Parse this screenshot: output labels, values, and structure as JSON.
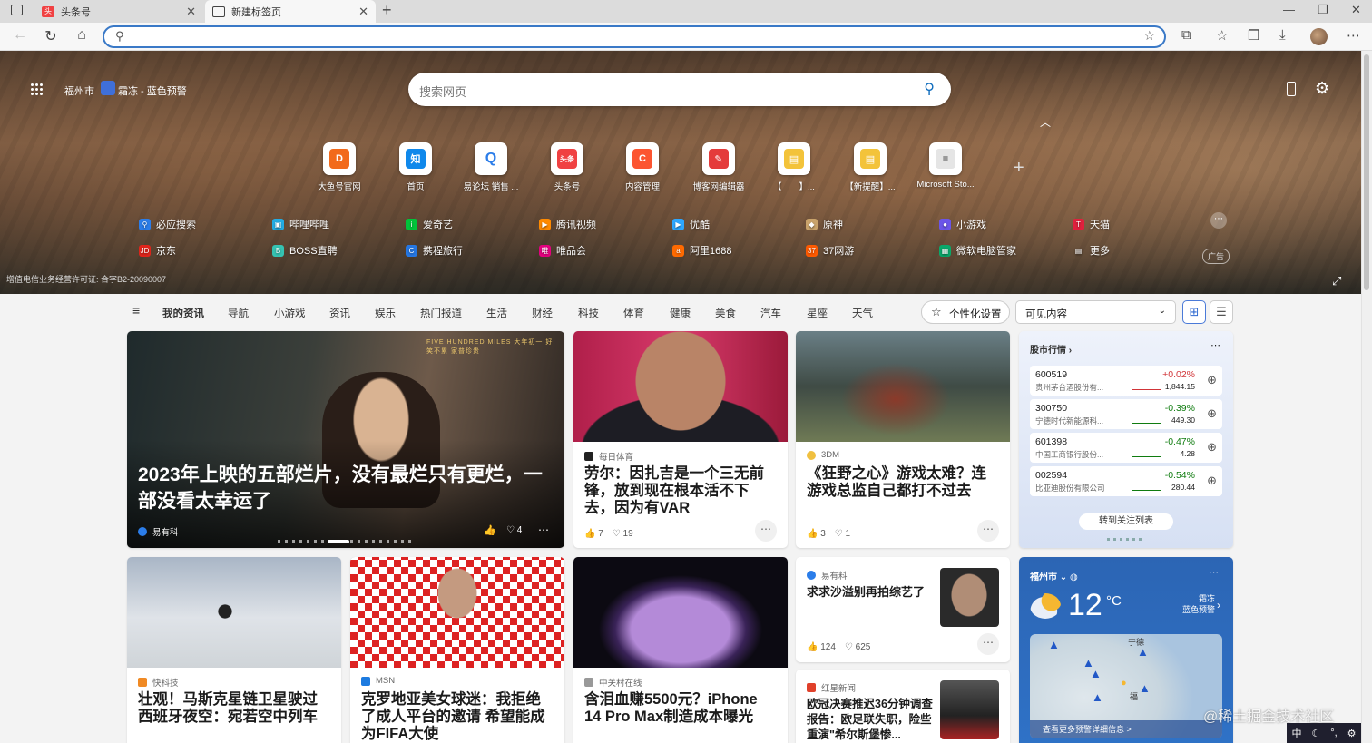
{
  "browser": {
    "tabs": [
      {
        "label": "头条号",
        "icon": "toutiao-icon"
      },
      {
        "label": "新建标签页",
        "icon": "newtab-icon"
      }
    ],
    "new_tab": "+",
    "window": {
      "min": "—",
      "max": "❐",
      "close": "✕"
    }
  },
  "hero": {
    "location": "福州市",
    "alert": "霜冻 - 蓝色预警",
    "search_placeholder": "搜索网页",
    "license": "增值电信业务经营许可证: 合字B2-20090007",
    "ad_badge": "广告",
    "quicklinks": [
      {
        "label": "大鱼号官网",
        "glyph": "D",
        "color": "#f26a1b"
      },
      {
        "label": "首页",
        "glyph": "知",
        "color": "#0f88eb"
      },
      {
        "label": "易论坛 销售 ...",
        "glyph": "Q",
        "color": "#2b7de9"
      },
      {
        "label": "头条号",
        "glyph": "头条",
        "color": "#f04142"
      },
      {
        "label": "内容管理",
        "glyph": "C",
        "color": "#fc5531"
      },
      {
        "label": "博客网编辑器",
        "glyph": "✎",
        "color": "#e43b3b"
      },
      {
        "label": "【　　】...",
        "glyph": "▤",
        "color": "#f3c33a"
      },
      {
        "label": "【新提醒】...",
        "glyph": "▤",
        "color": "#f3c33a"
      },
      {
        "label": "Microsoft Sto...",
        "glyph": "■",
        "color": "#bbb"
      }
    ],
    "add_link": "+",
    "sites_row1": [
      {
        "label": "必应搜索",
        "color": "#2b7de9"
      },
      {
        "label": "哔哩哔哩",
        "color": "#23ade5"
      },
      {
        "label": "爱奇艺",
        "color": "#00c43a"
      },
      {
        "label": "腾讯视频",
        "color": "#ff8a00"
      },
      {
        "label": "优酷",
        "color": "#2da7ff"
      },
      {
        "label": "原神",
        "color": "#c9a36b"
      },
      {
        "label": "小游戏",
        "color": "#6b55e8"
      },
      {
        "label": "天猫",
        "color": "#e0213d"
      }
    ],
    "sites_row2": [
      {
        "label": "京东",
        "color": "#e1251b"
      },
      {
        "label": "BOSS直聘",
        "color": "#35c3b2"
      },
      {
        "label": "携程旅行",
        "color": "#2577e3"
      },
      {
        "label": "唯品会",
        "color": "#e4007f"
      },
      {
        "label": "阿里1688",
        "color": "#ff6a00"
      },
      {
        "label": "37网游",
        "color": "#ff5a00"
      },
      {
        "label": "微软电脑管家",
        "color": "#0aa86a"
      },
      {
        "label": "更多",
        "color": "#888"
      }
    ]
  },
  "nav": {
    "items": [
      "我的资讯",
      "导航",
      "小游戏",
      "资讯",
      "娱乐",
      "热门报道",
      "生活",
      "财经",
      "科技",
      "体育",
      "健康",
      "美食",
      "汽车",
      "星座",
      "天气"
    ],
    "personalize": "个性化设置",
    "visible_content": "可见内容"
  },
  "feed": {
    "hero_card": {
      "title": "2023年上映的五部烂片，没有最烂只有更烂，一部没看太幸运了",
      "source": "易有科",
      "likes": "",
      "comments": "4",
      "banner": "FIVE HUNDRED MILES 大年初一 好笑不累 家普珍贵"
    },
    "c2": {
      "source": "每日体育",
      "title": "劳尔：因扎吉是一个三无前锋，放到现在根本活不下去，因为有VAR",
      "likes": "7",
      "comments": "19"
    },
    "c3": {
      "source": "3DM",
      "title": "《狂野之心》游戏太难？连游戏总监自己都打不过去",
      "likes": "3",
      "comments": "1"
    },
    "c4": {
      "source": "快科技",
      "title": "壮观！马斯克星链卫星驶过西班牙夜空：宛若空中列车"
    },
    "c5": {
      "source": "MSN",
      "title": "克罗地亚美女球迷：我拒绝了成人平台的邀请 希望能成为FIFA大使"
    },
    "c6": {
      "source": "中关村在线",
      "title": "含泪血赚5500元？iPhone 14 Pro Max制造成本曝光"
    },
    "c7": {
      "source": "易有料",
      "title": "求求沙溢别再拍综艺了",
      "likes": "124",
      "comments": "625"
    },
    "c8": {
      "source": "红星新闻",
      "title": "欧冠决赛推迟36分钟调查报告：欧足联失职，险些重演\"希尔斯堡惨..."
    }
  },
  "stock": {
    "title": "股市行情",
    "rows": [
      {
        "code": "600519",
        "name": "贵州茅台酒股份有...",
        "change": "+0.02%",
        "price": "1,844.15",
        "color": "#d13438"
      },
      {
        "code": "300750",
        "name": "宁德时代新能源科...",
        "change": "-0.39%",
        "price": "449.30",
        "color": "#107c10"
      },
      {
        "code": "601398",
        "name": "中国工商银行股份...",
        "change": "-0.47%",
        "price": "4.28",
        "color": "#107c10"
      },
      {
        "code": "002594",
        "name": "比亚迪股份有限公司",
        "change": "-0.54%",
        "price": "280.44",
        "color": "#107c10"
      }
    ],
    "watch_btn": "转到关注列表"
  },
  "weather": {
    "city": "福州市",
    "temp": "12",
    "unit": "°C",
    "alert": "霜冻",
    "alert2": "蓝色预警",
    "map_city": "宁德",
    "map_city2": "福",
    "more": "查看更多预警详细信息 >"
  },
  "watermark": "@稀土掘金技术社区",
  "taskbar": [
    "中",
    "☾",
    "°,",
    "⚙"
  ]
}
